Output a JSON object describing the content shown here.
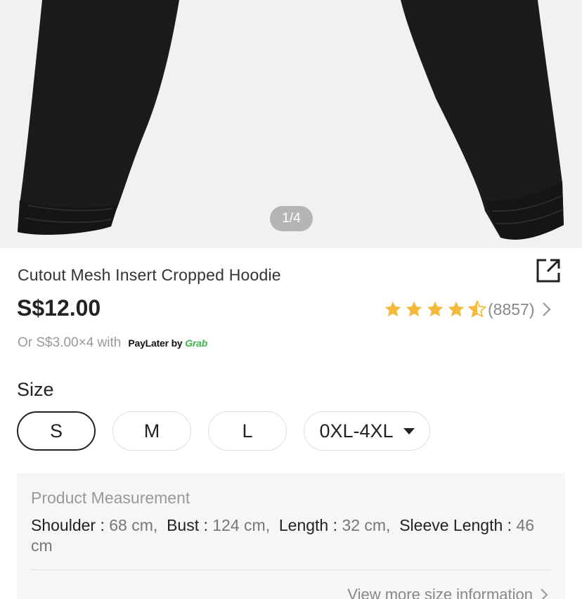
{
  "gallery": {
    "pager": "1/4"
  },
  "product": {
    "title": "Cutout Mesh Insert Cropped Hoodie",
    "price": "S$12.00",
    "rating": 4.5,
    "review_count": "(8857)",
    "installment_text": "Or S$3.00×4 with",
    "paylater_brand": "PayLater by",
    "paylater_partner": "Grab"
  },
  "size": {
    "label": "Size",
    "options": [
      "S",
      "M",
      "L",
      "0XL-4XL"
    ],
    "selected": "S"
  },
  "measurement": {
    "title": "Product Measurement",
    "items": [
      {
        "key": "Shoulder : ",
        "value": "68 cm,"
      },
      {
        "key": "Bust : ",
        "value": "124 cm,"
      },
      {
        "key": "Length : ",
        "value": "32 cm,"
      },
      {
        "key": "Sleeve Length : ",
        "value": "46 cm"
      }
    ],
    "more_link": "View more size information"
  },
  "colors": {
    "star": "#f5b93c",
    "grab_green": "#3bb54a",
    "garment": "#1b1b1b"
  },
  "icons": {
    "share": "share-icon",
    "star": "star-icon",
    "chevron": "chevron-right-icon"
  }
}
